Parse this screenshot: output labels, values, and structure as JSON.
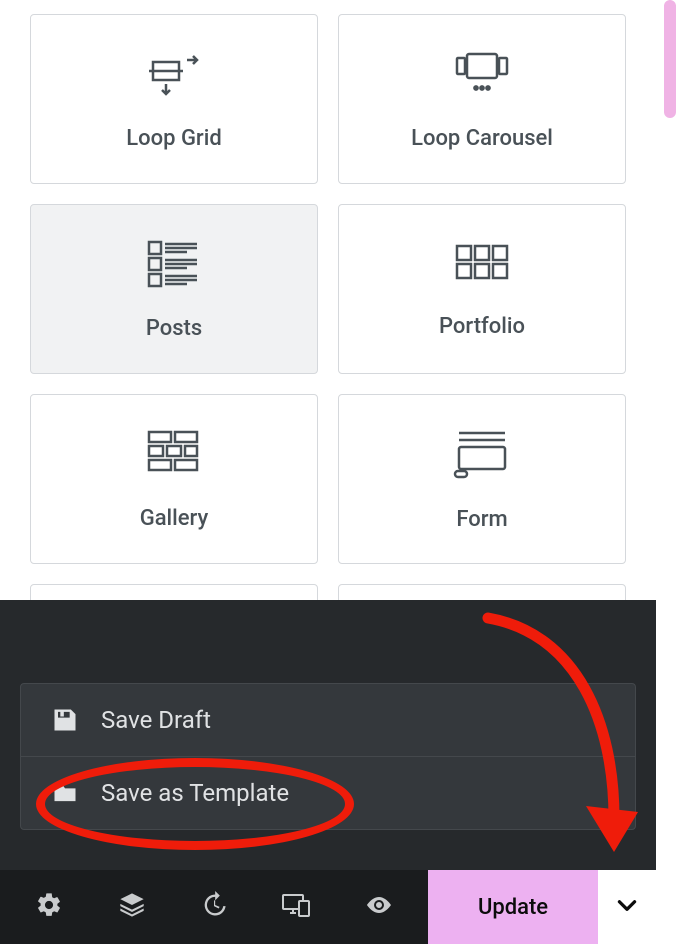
{
  "widgets": {
    "items": [
      {
        "label": "Loop Grid",
        "icon": "loop-grid-icon",
        "hover": false
      },
      {
        "label": "Loop Carousel",
        "icon": "loop-carousel-icon",
        "hover": false
      },
      {
        "label": "Posts",
        "icon": "posts-icon",
        "hover": true
      },
      {
        "label": "Portfolio",
        "icon": "portfolio-icon",
        "hover": false
      },
      {
        "label": "Gallery",
        "icon": "gallery-icon",
        "hover": false
      },
      {
        "label": "Form",
        "icon": "form-icon",
        "hover": false
      }
    ]
  },
  "save_menu": {
    "draft_label": "Save Draft",
    "template_label": "Save as Template"
  },
  "bottom_bar": {
    "update_label": "Update"
  },
  "colors": {
    "accent_pink": "#edb1f1",
    "annotation_red": "#ef1c0a",
    "panel_dark": "#26292c"
  }
}
